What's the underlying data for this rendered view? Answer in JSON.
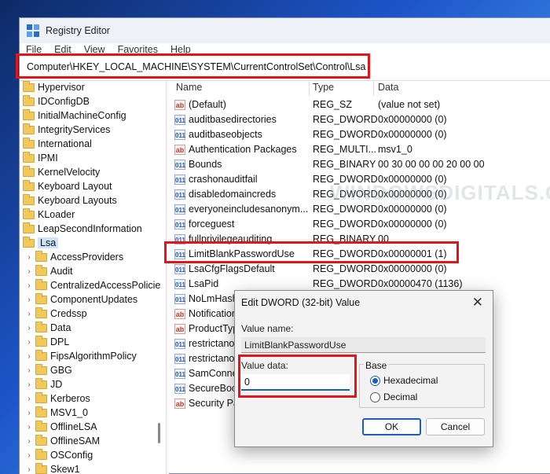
{
  "window": {
    "title": "Registry Editor"
  },
  "menu": [
    "File",
    "Edit",
    "View",
    "Favorites",
    "Help"
  ],
  "address": "Computer\\HKEY_LOCAL_MACHINE\\SYSTEM\\CurrentControlSet\\Control\\Lsa",
  "tree": [
    {
      "label": "Hypervisor",
      "level": 0
    },
    {
      "label": "IDConfigDB",
      "level": 0
    },
    {
      "label": "InitialMachineConfig",
      "level": 0
    },
    {
      "label": "IntegrityServices",
      "level": 0
    },
    {
      "label": "International",
      "level": 0
    },
    {
      "label": "IPMI",
      "level": 0
    },
    {
      "label": "KernelVelocity",
      "level": 0
    },
    {
      "label": "Keyboard Layout",
      "level": 0
    },
    {
      "label": "Keyboard Layouts",
      "level": 0
    },
    {
      "label": "KLoader",
      "level": 0
    },
    {
      "label": "LeapSecondInformation",
      "level": 0
    },
    {
      "label": "Lsa",
      "level": 0,
      "selected": true
    },
    {
      "label": "AccessProviders",
      "level": 1
    },
    {
      "label": "Audit",
      "level": 1
    },
    {
      "label": "CentralizedAccessPolicie",
      "level": 1
    },
    {
      "label": "ComponentUpdates",
      "level": 1
    },
    {
      "label": "Credssp",
      "level": 1
    },
    {
      "label": "Data",
      "level": 1
    },
    {
      "label": "DPL",
      "level": 1
    },
    {
      "label": "FipsAlgorithmPolicy",
      "level": 1
    },
    {
      "label": "GBG",
      "level": 1
    },
    {
      "label": "JD",
      "level": 1
    },
    {
      "label": "Kerberos",
      "level": 1
    },
    {
      "label": "MSV1_0",
      "level": 1
    },
    {
      "label": "OfflineLSA",
      "level": 1
    },
    {
      "label": "OfflineSAM",
      "level": 1
    },
    {
      "label": "OSConfig",
      "level": 1
    },
    {
      "label": "Skew1",
      "level": 1
    }
  ],
  "list": {
    "headers": {
      "name": "Name",
      "type": "Type",
      "data": "Data"
    },
    "rows": [
      {
        "icon": "ab",
        "name": "(Default)",
        "type": "REG_SZ",
        "data": "(value not set)"
      },
      {
        "icon": "bin",
        "name": "auditbasedirectories",
        "type": "REG_DWORD",
        "data": "0x00000000 (0)"
      },
      {
        "icon": "bin",
        "name": "auditbaseobjects",
        "type": "REG_DWORD",
        "data": "0x00000000 (0)"
      },
      {
        "icon": "ab",
        "name": "Authentication Packages",
        "type": "REG_MULTI...",
        "data": "msv1_0"
      },
      {
        "icon": "bin",
        "name": "Bounds",
        "type": "REG_BINARY",
        "data": "00 30 00 00 00 20 00 00"
      },
      {
        "icon": "bin",
        "name": "crashonauditfail",
        "type": "REG_DWORD",
        "data": "0x00000000 (0)"
      },
      {
        "icon": "bin",
        "name": "disabledomaincreds",
        "type": "REG_DWORD",
        "data": "0x00000000 (0)"
      },
      {
        "icon": "bin",
        "name": "everyoneincludesanonym...",
        "type": "REG_DWORD",
        "data": "0x00000000 (0)"
      },
      {
        "icon": "bin",
        "name": "forceguest",
        "type": "REG_DWORD",
        "data": "0x00000000 (0)"
      },
      {
        "icon": "bin",
        "name": "fullprivilegeauditing",
        "type": "REG_BINARY",
        "data": "00"
      },
      {
        "icon": "bin",
        "name": "LimitBlankPasswordUse",
        "type": "REG_DWORD",
        "data": "0x00000001 (1)"
      },
      {
        "icon": "bin",
        "name": "LsaCfgFlagsDefault",
        "type": "REG_DWORD",
        "data": "0x00000000 (0)"
      },
      {
        "icon": "bin",
        "name": "LsaPid",
        "type": "REG_DWORD",
        "data": "0x00000470 (1136)"
      },
      {
        "icon": "bin",
        "name": "NoLmHash",
        "type": "",
        "data": ""
      },
      {
        "icon": "ab",
        "name": "Notification",
        "type": "",
        "data": ""
      },
      {
        "icon": "ab",
        "name": "ProductTyp",
        "type": "",
        "data": ""
      },
      {
        "icon": "bin",
        "name": "restrictanor",
        "type": "",
        "data": ""
      },
      {
        "icon": "bin",
        "name": "restrictanor",
        "type": "",
        "data": ""
      },
      {
        "icon": "bin",
        "name": "SamConne",
        "type": "",
        "data": ""
      },
      {
        "icon": "bin",
        "name": "SecureBoot",
        "type": "",
        "data": ""
      },
      {
        "icon": "ab",
        "name": "Security Pa",
        "type": "",
        "data": ""
      }
    ]
  },
  "watermark": "WINDOWSDIGITALS.COM",
  "dialog": {
    "title": "Edit DWORD (32-bit) Value",
    "value_name_label": "Value name:",
    "value_name": "LimitBlankPasswordUse",
    "value_data_label": "Value data:",
    "value_data": "0",
    "base_label": "Base",
    "radio_hex": "Hexadecimal",
    "radio_dec": "Decimal",
    "ok": "OK",
    "cancel": "Cancel"
  },
  "colors": {
    "highlight": "#e0161b",
    "accent": "#1a5fb4",
    "folder": "#f3c85a"
  }
}
